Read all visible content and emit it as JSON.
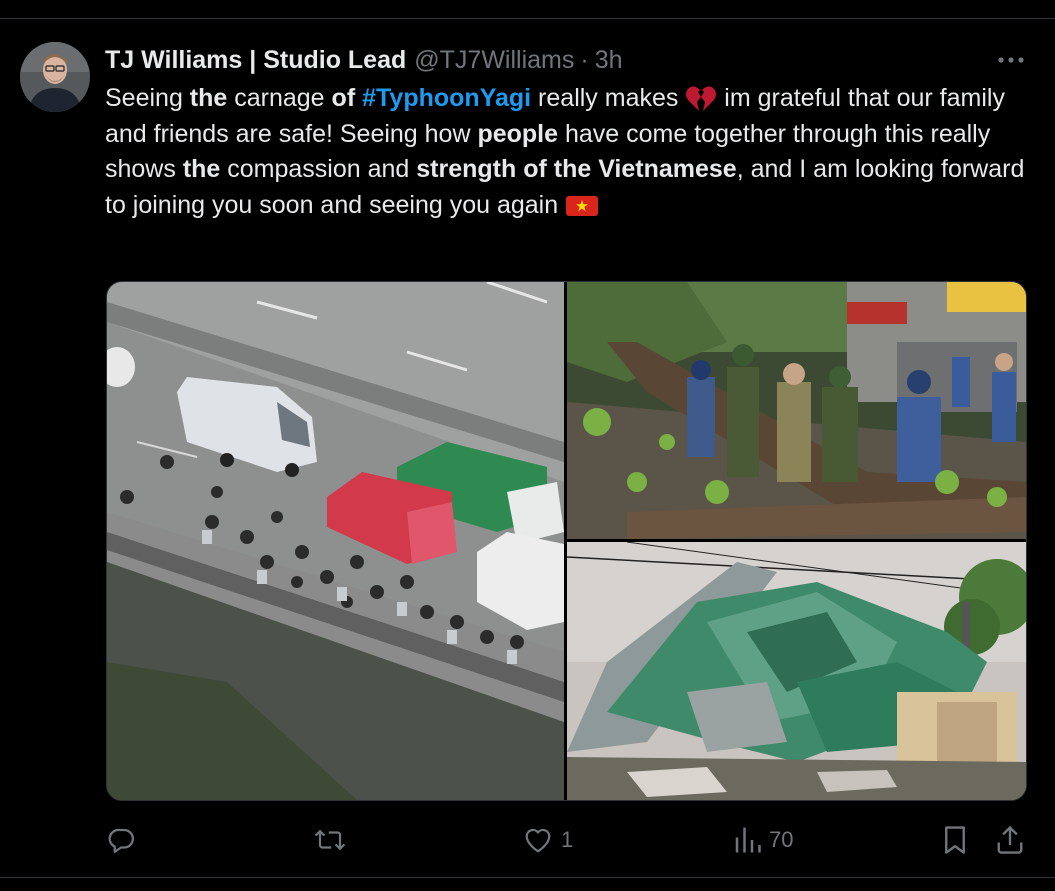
{
  "tweet": {
    "author_name": "TJ Williams | Studio Lead",
    "handle": "@TJ7Williams",
    "separator": "·",
    "time": "3h",
    "more_icon": "more-horizontal-icon",
    "text": {
      "t1": "Seeing ",
      "t2": "the",
      "t3": " carnage ",
      "t4": "of",
      "t5": " ",
      "hashtag": "#TyphoonYagi",
      "t6": " really makes ",
      "t7": " im grateful that our family and friends are safe! Seeing how ",
      "t8": "people",
      "t9": " have come together through this really shows ",
      "t10": "the",
      "t11": " compassion and ",
      "t12": "strength of the Vietnamese",
      "t13": ", and I am looking forward to joining you soon and seeing you again ",
      "emoji_1": "broken-heart-emoji",
      "emoji_2": "vietnam-flag-emoji"
    },
    "media": [
      {
        "name": "flooded-highway-traffic-photo"
      },
      {
        "name": "soldiers-lifting-fallen-tree-photo"
      },
      {
        "name": "collapsed-metal-roof-building-photo"
      }
    ],
    "actions": {
      "reply_icon": "reply-icon",
      "retweet_icon": "retweet-icon",
      "like_icon": "heart-icon",
      "like_count": "1",
      "views_icon": "views-chart-icon",
      "views_count": "70",
      "bookmark_icon": "bookmark-icon",
      "share_icon": "share-icon"
    },
    "colors": {
      "background": "#000000",
      "text": "#e7e9ea",
      "secondary": "#71767b",
      "link": "#1d9bf0",
      "border": "#2f3336"
    }
  }
}
